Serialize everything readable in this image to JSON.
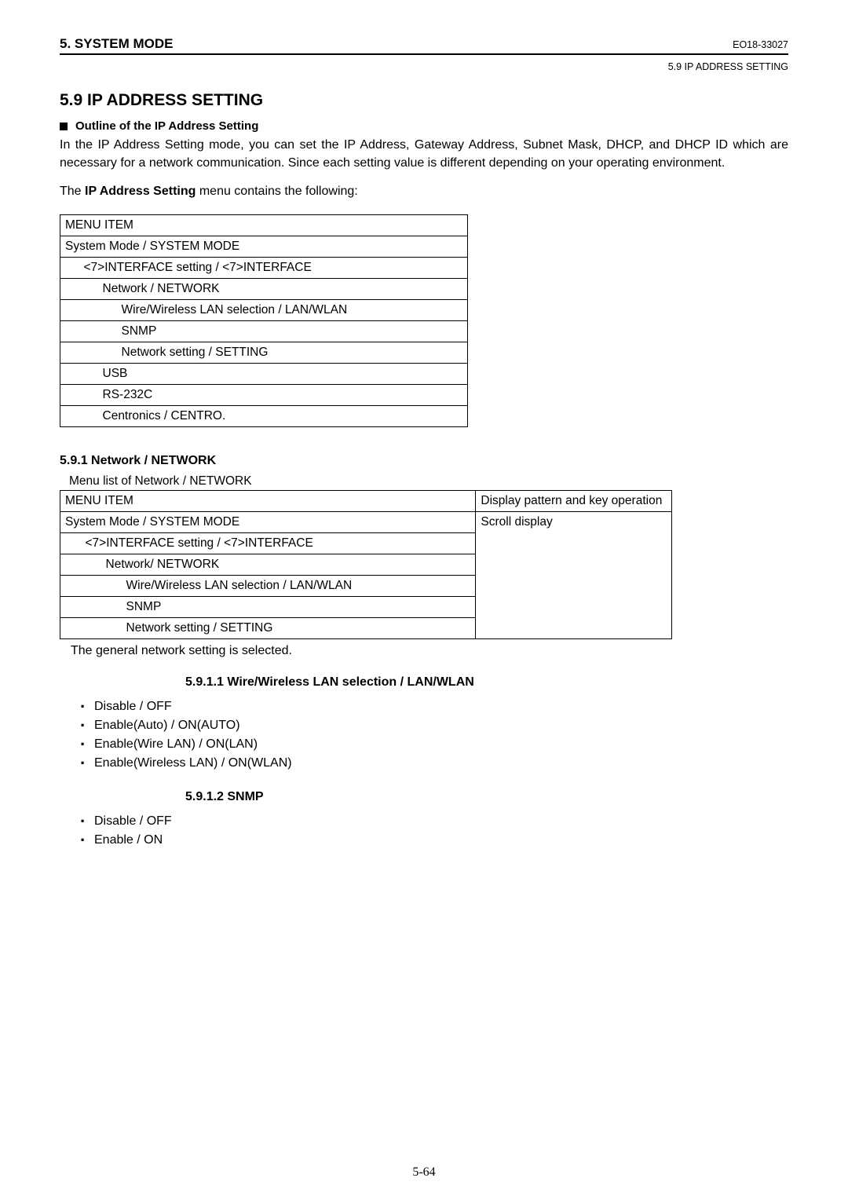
{
  "header": {
    "left": "5. SYSTEM MODE",
    "right": "EO18-33027",
    "sub": "5.9 IP ADDRESS SETTING"
  },
  "section": {
    "number_title": "5.9  IP ADDRESS SETTING",
    "outline_label": "Outline of the IP Address Setting",
    "intro": "In the IP Address Setting mode, you can set the IP Address, Gateway Address, Subnet Mask, DHCP, and DHCP ID which are necessary for a network communication.  Since each setting value is different depending on your operating environment.",
    "menu_sentence_pre": "The ",
    "menu_sentence_bold": "IP Address Setting",
    "menu_sentence_post": " menu contains the following:"
  },
  "menu1": {
    "header": "MENU ITEM",
    "r1": "System Mode / SYSTEM MODE",
    "r2": "<7>INTERFACE setting / <7>INTERFACE",
    "r3": "Network / NETWORK",
    "r4": "Wire/Wireless LAN selection / LAN/WLAN",
    "r5": "SNMP",
    "r6": "Network setting / SETTING",
    "r7": "USB",
    "r8": "RS-232C",
    "r9": "Centronics / CENTRO."
  },
  "sec591": {
    "heading": "5.9.1  Network / NETWORK",
    "caption": "Menu list of Network / NETWORK"
  },
  "menu2": {
    "h_left": "MENU ITEM",
    "h_right": "Display pattern and key operation",
    "r1": "System Mode / SYSTEM MODE",
    "r1_right": "Scroll display",
    "r2": "<7>INTERFACE setting / <7>INTERFACE",
    "r3": "Network/ NETWORK",
    "r4": "Wire/Wireless LAN selection / LAN/WLAN",
    "r5": "SNMP",
    "r6": "Network setting / SETTING"
  },
  "after_table": "The general network setting is selected.",
  "sec5911": {
    "heading": "5.9.1.1  Wire/Wireless LAN selection / LAN/WLAN",
    "opts": [
      "Disable / OFF",
      "Enable(Auto) / ON(AUTO)",
      "Enable(Wire LAN) / ON(LAN)",
      "Enable(Wireless LAN) / ON(WLAN)"
    ]
  },
  "sec5912": {
    "heading": "5.9.1.2  SNMP",
    "opts": [
      "Disable / OFF",
      "Enable / ON"
    ]
  },
  "page_num": "5-64"
}
